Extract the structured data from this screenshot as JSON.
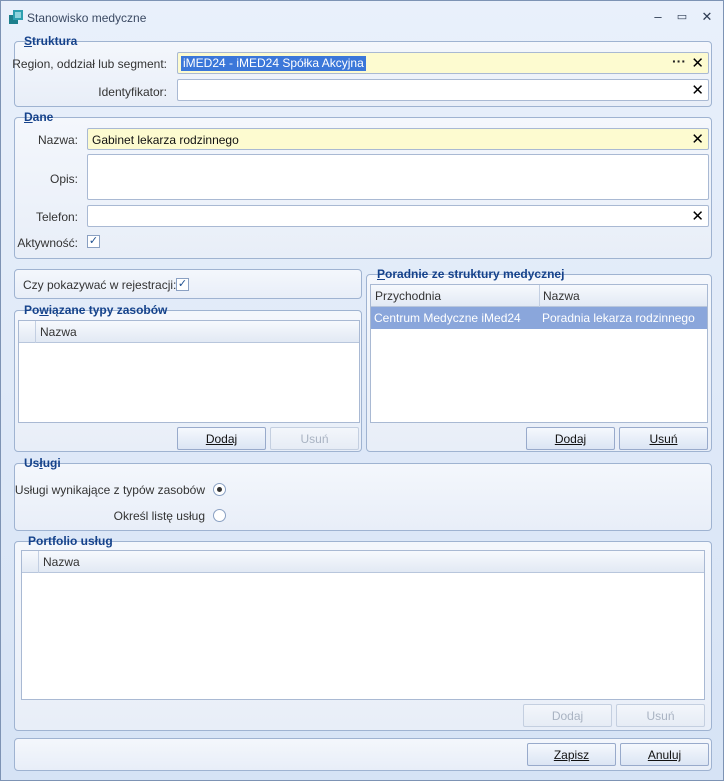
{
  "window": {
    "title": "Stanowisko medyczne",
    "minimize": "–",
    "maximize": "▭",
    "close": "✕"
  },
  "struktura": {
    "legend_ul": "S",
    "legend_rest": "truktura",
    "region_label": "Region, oddział lub segment:",
    "region_value": "iMED24 - iMED24 Spółka Akcyjna",
    "identyfikator_label": "Identyfikator:",
    "identyfikator_value": ""
  },
  "dane": {
    "legend_ul": "D",
    "legend_rest": "ane",
    "nazwa_label": "Nazwa:",
    "nazwa_value": "Gabinet lekarza rodzinnego",
    "opis_label": "Opis:",
    "opis_value": "",
    "telefon_label": "Telefon:",
    "telefon_value": "",
    "aktywnosc_label": "Aktywność:",
    "aktywnosc_checked": "✓"
  },
  "rejestracja": {
    "label": "Czy pokazywać w rejestracji:",
    "checked": "✓"
  },
  "powiazane": {
    "legend_pre": "Po",
    "legend_ul": "w",
    "legend_rest": "iązane typy zasobów",
    "column": "Nazwa",
    "add": "Dodaj",
    "remove": "Usuń"
  },
  "poradnie": {
    "legend_ul": "P",
    "legend_rest": "oradnie ze struktury medycznej",
    "columns": [
      "Przychodnia",
      "Nazwa"
    ],
    "rows": [
      {
        "przychodnia": "Centrum Medyczne iMed24",
        "nazwa": "Poradnia lekarza rodzinnego"
      }
    ],
    "add": "Dodaj",
    "remove": "Usuń"
  },
  "uslugi": {
    "legend_pre": "Us",
    "legend_ul": "ł",
    "legend_rest": "ugi",
    "option1": "Usługi wynikające z typów zasobów",
    "option2": "Określ listę usług"
  },
  "portfolio": {
    "legend": "Portfolio usług",
    "column": "Nazwa",
    "add": "Dodaj",
    "remove": "Usuń"
  },
  "footer": {
    "save": "Zapisz",
    "cancel": "Anuluj"
  }
}
